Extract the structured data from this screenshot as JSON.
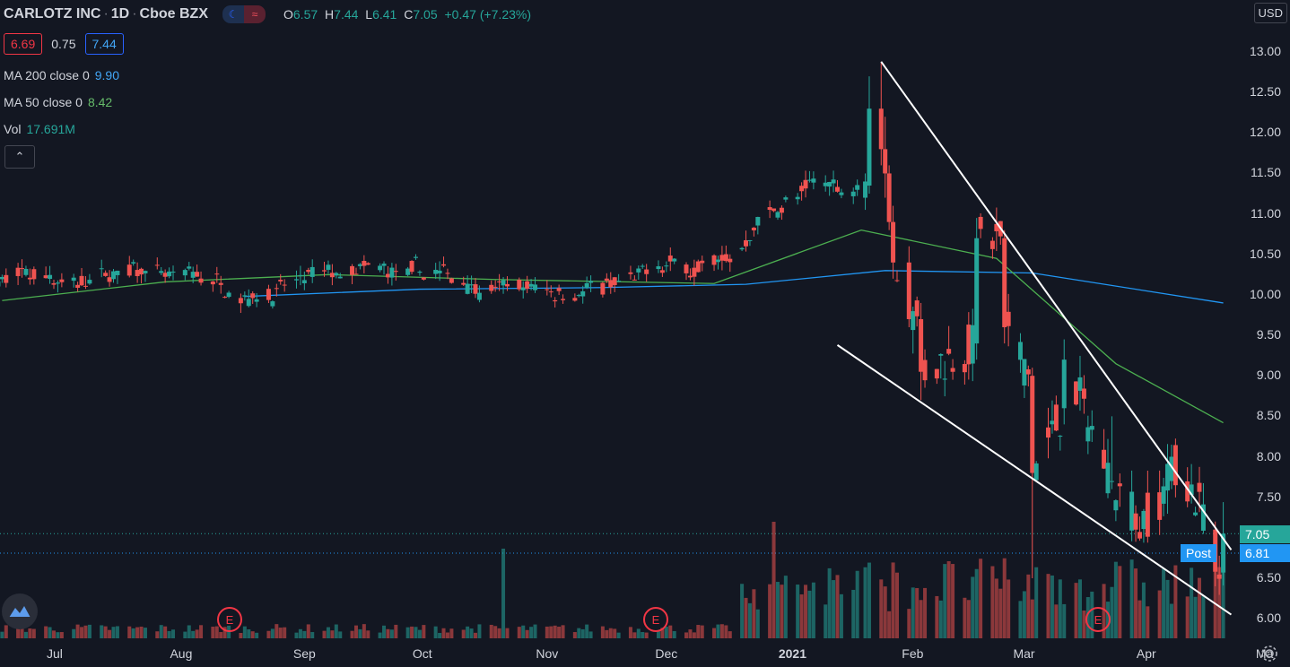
{
  "header": {
    "symbol": "CARLOTZ INC",
    "interval": "1D",
    "exchange": "Cboe BZX",
    "open_label": "O",
    "open": "6.57",
    "high_label": "H",
    "high": "7.44",
    "low_label": "L",
    "low": "6.41",
    "close_label": "C",
    "close": "7.05",
    "change": "+0.47 (+7.23%)",
    "mode_icons": [
      "moon-icon",
      "wave-icon"
    ]
  },
  "quote": {
    "bid": "6.69",
    "spread": "0.75",
    "ask": "7.44"
  },
  "legend": {
    "ma200_label": "MA 200 close 0",
    "ma200_value": "9.90",
    "ma50_label": "MA 50 close 0",
    "ma50_value": "8.42",
    "vol_label": "Vol",
    "vol_value": "17.691M"
  },
  "toolbar": {
    "collapse_glyph": "⌃",
    "currency": "USD"
  },
  "price_tags": {
    "last": "7.05",
    "post_label": "Post",
    "post": "6.81"
  },
  "earnings_marker": "E",
  "colors": {
    "bg": "#131722",
    "up": "#26a69a",
    "down": "#ef5350",
    "ma200": "#2196f3",
    "ma50": "#4caf50",
    "trendline": "#ffffff"
  },
  "chart_data": {
    "type": "candlestick",
    "title": "CARLOTZ INC · 1D · Cboe BZX",
    "y_ticks": [
      "13.00",
      "12.50",
      "12.00",
      "11.50",
      "11.00",
      "10.50",
      "10.00",
      "9.50",
      "9.00",
      "8.50",
      "8.00",
      "7.50",
      "7.00",
      "6.50",
      "6.00"
    ],
    "ylim": [
      6.0,
      13.0
    ],
    "x_ticks": [
      "Jul",
      "Aug",
      "Sep",
      "Oct",
      "Nov",
      "Dec",
      "2021",
      "Feb",
      "Mar",
      "Apr",
      "Ma"
    ],
    "trend_segments": [
      {
        "name": "upper-trendline",
        "x": [
          "2021-01-25",
          "2021-04-23"
        ],
        "y": [
          12.88,
          6.85
        ]
      },
      {
        "name": "lower-trendline",
        "x": [
          "2021-01-14",
          "2021-04-23"
        ],
        "y": [
          9.38,
          6.05
        ]
      }
    ],
    "series": [
      {
        "name": "MA 200 close 0",
        "x": [
          "2020-08-18",
          "2020-10-01",
          "2020-11-16",
          "2020-12-22",
          "2021-01-26",
          "2021-03-04",
          "2021-04-21"
        ],
        "y": [
          9.98,
          10.07,
          10.09,
          10.13,
          10.3,
          10.27,
          9.9
        ]
      },
      {
        "name": "MA 50 close 0",
        "x": [
          "2020-06-18",
          "2020-07-29",
          "2020-09-08",
          "2020-10-20",
          "2020-12-14",
          "2021-01-20",
          "2021-02-23",
          "2021-03-25",
          "2021-04-21"
        ],
        "y": [
          9.93,
          10.16,
          10.25,
          10.19,
          10.14,
          10.8,
          10.45,
          9.15,
          8.42
        ]
      }
    ],
    "ohlc_recent": [
      {
        "x": "2021-01-21",
        "o": 11.2,
        "h": 11.5,
        "l": 11.05,
        "c": 11.4
      },
      {
        "x": "2021-01-22",
        "o": 11.35,
        "h": 12.7,
        "l": 11.25,
        "c": 12.3
      },
      {
        "x": "2021-01-25",
        "o": 12.3,
        "h": 12.88,
        "l": 11.6,
        "c": 11.8
      },
      {
        "x": "2021-01-26",
        "o": 11.8,
        "h": 12.2,
        "l": 11.2,
        "c": 11.5
      },
      {
        "x": "2021-01-27",
        "o": 11.5,
        "h": 11.6,
        "l": 10.8,
        "c": 10.9
      },
      {
        "x": "2021-01-28",
        "o": 10.9,
        "h": 11.1,
        "l": 10.2,
        "c": 10.4
      },
      {
        "x": "2021-02-01",
        "o": 10.4,
        "h": 10.6,
        "l": 9.6,
        "c": 9.7
      },
      {
        "x": "2021-02-04",
        "o": 9.7,
        "h": 9.9,
        "l": 8.7,
        "c": 9.05
      },
      {
        "x": "2021-02-18",
        "o": 9.4,
        "h": 10.95,
        "l": 9.2,
        "c": 10.7
      },
      {
        "x": "2021-02-25",
        "o": 10.7,
        "h": 10.8,
        "l": 9.4,
        "c": 9.6
      },
      {
        "x": "2021-03-04",
        "o": 9.0,
        "h": 9.1,
        "l": 6.5,
        "c": 7.8
      },
      {
        "x": "2021-03-12",
        "o": 8.6,
        "h": 9.45,
        "l": 8.4,
        "c": 9.2
      },
      {
        "x": "2021-03-24",
        "o": 7.7,
        "h": 8.5,
        "l": 7.6,
        "c": 7.7
      },
      {
        "x": "2021-03-30",
        "o": 7.3,
        "h": 7.4,
        "l": 6.95,
        "c": 7.1
      },
      {
        "x": "2021-04-08",
        "o": 7.7,
        "h": 8.15,
        "l": 7.6,
        "c": 8.0
      },
      {
        "x": "2021-04-19",
        "o": 7.1,
        "h": 7.2,
        "l": 6.4,
        "c": 6.58
      },
      {
        "x": "2021-04-21",
        "o": 6.57,
        "h": 7.44,
        "l": 6.41,
        "c": 7.05
      }
    ]
  }
}
